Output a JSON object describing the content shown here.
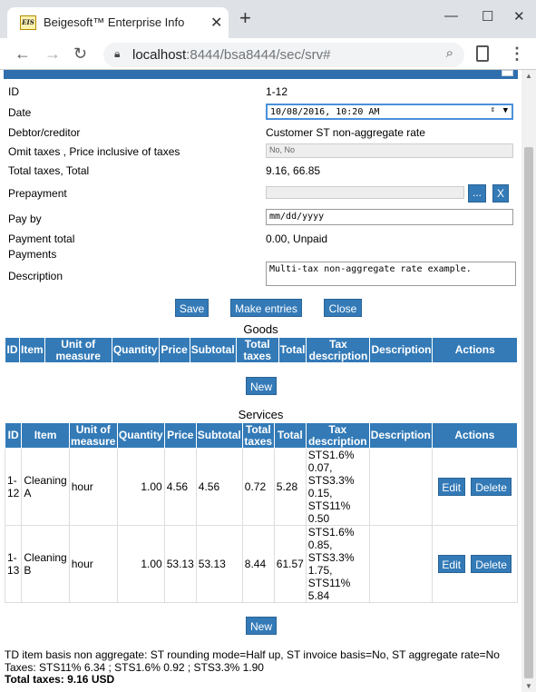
{
  "browser": {
    "tab_title": "Beigesoft™ Enterprise Info",
    "favicon": "EIS",
    "url_host": "localhost",
    "url_rest": ":8444/bsa8444/sec/srv#",
    "new_tab": "+",
    "minimize": "—",
    "maximize": "☐",
    "close": "✕"
  },
  "form": {
    "id_label": "ID",
    "id_value": "1-12",
    "date_label": "Date",
    "date_value": "10/08/2016, 10:20 AM",
    "debtor_label": "Debtor/creditor",
    "debtor_value": "Customer ST non-aggregate rate",
    "omit_label": "Omit taxes , Price inclusive of taxes",
    "omit_value": "No, No",
    "totals_label": "Total taxes, Total",
    "totals_value": "9.16, 66.85",
    "prepayment_label": "Prepayment",
    "prepayment_pick": "...",
    "prepayment_clear": "X",
    "payby_label": "Pay by",
    "payby_placeholder": "mm/dd/yyyy",
    "paytotal_label": "Payment total",
    "paytotal_value": "0.00, Unpaid",
    "payments_label": "Payments",
    "description_label": "Description",
    "description_value": "Multi-tax non-aggregate rate example."
  },
  "buttons": {
    "save": "Save",
    "make_entries": "Make entries",
    "close": "Close",
    "new": "New",
    "edit": "Edit",
    "delete": "Delete"
  },
  "goods": {
    "title": "Goods",
    "headers": [
      "ID",
      "Item",
      "Unit of measure",
      "Quantity",
      "Price",
      "Subtotal",
      "Total taxes",
      "Total",
      "Tax description",
      "Description",
      "Actions"
    ]
  },
  "services": {
    "title": "Services",
    "headers": [
      "ID",
      "Item",
      "Unit of measure",
      "Quantity",
      "Price",
      "Subtotal",
      "Total taxes",
      "Total",
      "Tax description",
      "Description",
      "Actions"
    ],
    "rows": [
      {
        "id": "1-12",
        "item": "Cleaning A",
        "unit": "hour",
        "qty": "1.00",
        "price": "4.56",
        "subtotal": "4.56",
        "taxes": "0.72",
        "total": "5.28",
        "taxdesc": "STS1.6% 0.07, STS3.3% 0.15, STS11% 0.50",
        "desc": ""
      },
      {
        "id": "1-13",
        "item": "Cleaning B",
        "unit": "hour",
        "qty": "1.00",
        "price": "53.13",
        "subtotal": "53.13",
        "taxes": "8.44",
        "total": "61.57",
        "taxdesc": "STS1.6% 0.85, STS3.3% 1.75, STS11% 5.84",
        "desc": ""
      }
    ]
  },
  "footer": {
    "basis": "TD item basis non aggregate: ST rounding mode=Half up, ST invoice basis=No, ST aggregate rate=No",
    "taxes": "Taxes: STS11% 6.34 ; STS1.6% 0.92 ; STS3.3% 1.90",
    "total": "Total taxes: 9.16 USD"
  }
}
